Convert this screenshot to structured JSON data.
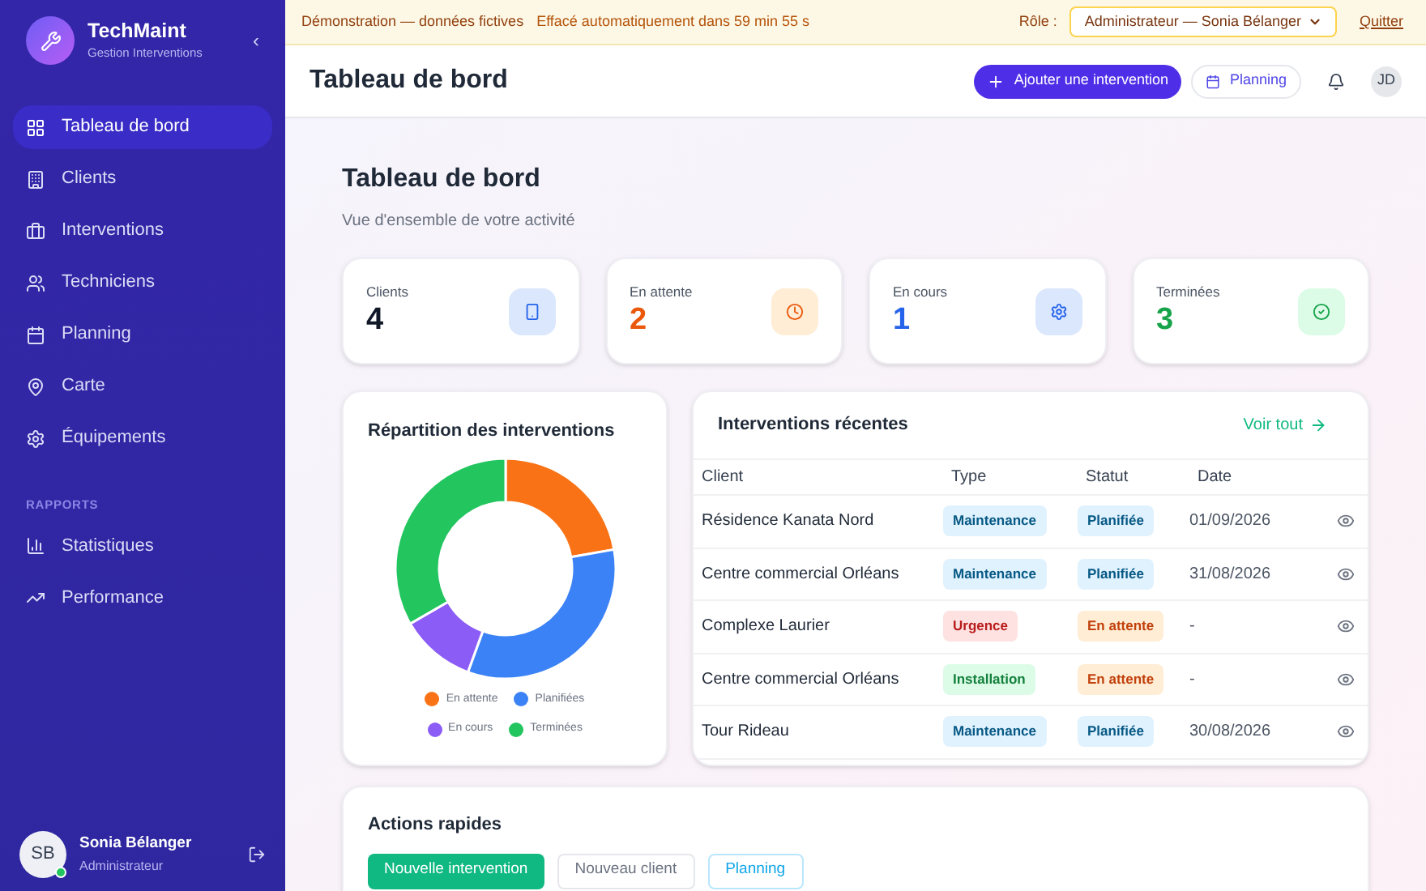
{
  "brand": {
    "name": "TechMaint",
    "subtitle": "Gestion Interventions",
    "collapse": "‹"
  },
  "nav": [
    {
      "kind": "dashboard",
      "label": "Tableau de bord",
      "selected": true
    },
    {
      "kind": "clients",
      "label": "Clients",
      "selected": false
    },
    {
      "kind": "interventions",
      "label": "Interventions",
      "selected": false
    },
    {
      "kind": "technicians",
      "label": "Techniciens",
      "selected": false
    },
    {
      "kind": "planning",
      "label": "Planning",
      "selected": false
    },
    {
      "kind": "map",
      "label": "Carte",
      "selected": false
    },
    {
      "kind": "equipment",
      "label": "Équipements",
      "selected": false
    }
  ],
  "reports": {
    "heading": "RAPPORTS",
    "items": [
      {
        "kind": "stats",
        "label": "Statistiques",
        "selected": false
      },
      {
        "kind": "performance",
        "label": "Performance",
        "selected": false
      }
    ]
  },
  "user": {
    "initials": "SB",
    "name": "Sonia Bélanger",
    "role": "Administrateur",
    "online": true
  },
  "banner": {
    "demo": "Démonstration — données fictives",
    "timer": "Effacé automatiquement dans 59 min 55 s",
    "role_label": "Rôle :",
    "role_value": "Administrateur — Sonia Bélanger",
    "quit": "Quitter"
  },
  "header": {
    "title": "Tableau de bord",
    "add_button": "Ajouter une intervention",
    "planning_button": "Planning",
    "avatar": "JD"
  },
  "page": {
    "title": "Tableau de bord",
    "subtitle": "Vue d'ensemble de votre activité"
  },
  "stats": [
    {
      "label": "Clients",
      "value": "4",
      "kind": "clients"
    },
    {
      "label": "En attente",
      "value": "2",
      "kind": "pending"
    },
    {
      "label": "En cours",
      "value": "1",
      "kind": "progress"
    },
    {
      "label": "Terminées",
      "value": "3",
      "kind": "done"
    }
  ],
  "distribution": {
    "title": "Répartition des interventions",
    "legend": [
      {
        "label": "En attente",
        "color": "#f97316"
      },
      {
        "label": "Planifiées",
        "color": "#3b82f6"
      },
      {
        "label": "En cours",
        "color": "#8b5cf6"
      },
      {
        "label": "Terminées",
        "color": "#22c55e"
      }
    ]
  },
  "recent": {
    "title": "Interventions récentes",
    "link": "Voir tout",
    "columns": [
      "Client",
      "Type",
      "Statut",
      "Date"
    ],
    "rows": [
      {
        "client": "Résidence Kanata Nord",
        "type": {
          "label": "Maintenance",
          "kind": "maintenance"
        },
        "status": {
          "label": "Planifiée",
          "kind": "planned"
        },
        "date": "01/09/2026"
      },
      {
        "client": "Centre commercial Orléans",
        "type": {
          "label": "Maintenance",
          "kind": "maintenance"
        },
        "status": {
          "label": "Planifiée",
          "kind": "planned"
        },
        "date": "31/08/2026"
      },
      {
        "client": "Complexe Laurier",
        "type": {
          "label": "Urgence",
          "kind": "urgent"
        },
        "status": {
          "label": "En attente",
          "kind": "pending"
        },
        "date": "-"
      },
      {
        "client": "Centre commercial Orléans",
        "type": {
          "label": "Installation",
          "kind": "install"
        },
        "status": {
          "label": "En attente",
          "kind": "pending"
        },
        "date": "-"
      },
      {
        "client": "Tour Rideau",
        "type": {
          "label": "Maintenance",
          "kind": "maintenance"
        },
        "status": {
          "label": "Planifiée",
          "kind": "planned"
        },
        "date": "30/08/2026"
      }
    ]
  },
  "quick_actions": {
    "title": "Actions rapides",
    "buttons": [
      {
        "label": "Nouvelle intervention",
        "kind": "primary"
      },
      {
        "label": "Nouveau client",
        "kind": "plain"
      },
      {
        "label": "Planning",
        "kind": "outline"
      }
    ]
  }
}
